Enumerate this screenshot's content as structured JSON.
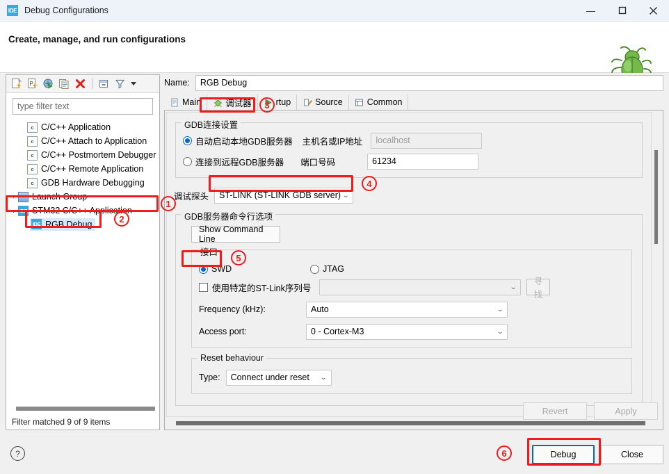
{
  "window": {
    "title": "Debug Configurations",
    "app_icon": "ide-icon",
    "minimize": "—",
    "maximize": "☐",
    "close": "✕"
  },
  "banner": {
    "heading": "Create, manage, and run configurations",
    "decoration_icon": "green-bug-icon"
  },
  "left_panel": {
    "toolbar_icons": [
      "new-configuration-icon",
      "new-prototype-icon",
      "export-icon",
      "duplicate-icon",
      "delete-icon",
      "collapse-all-icon",
      "filter-icon",
      "view-menu-caret-icon"
    ],
    "filter": {
      "placeholder": "type filter text",
      "value": ""
    },
    "tree": [
      {
        "label": "C/C++ Application",
        "icon": "c-file-icon",
        "indent": 1,
        "arrow": "",
        "selected": false
      },
      {
        "label": "C/C++ Attach to Application",
        "icon": "c-file-icon",
        "indent": 1,
        "arrow": "",
        "selected": false
      },
      {
        "label": "C/C++ Postmortem Debugger",
        "icon": "c-file-icon",
        "indent": 1,
        "arrow": "",
        "selected": false
      },
      {
        "label": "C/C++ Remote Application",
        "icon": "c-file-icon",
        "indent": 1,
        "arrow": "",
        "selected": false
      },
      {
        "label": "GDB Hardware Debugging",
        "icon": "c-file-icon",
        "indent": 1,
        "arrow": "",
        "selected": false
      },
      {
        "label": "Launch Group",
        "icon": "launch-group-icon",
        "indent": 0,
        "arrow": "›",
        "selected": false
      },
      {
        "label": "STM32 C/C++ Application",
        "icon": "ide-icon",
        "indent": 0,
        "arrow": "⌄",
        "selected": false
      },
      {
        "label": "RGB Debug",
        "icon": "ide-icon",
        "indent": 2,
        "arrow": "",
        "selected": true
      }
    ],
    "status": "Filter matched 9 of 9 items"
  },
  "right_panel": {
    "name_label": "Name:",
    "name_value": "RGB Debug",
    "tabs": [
      {
        "label": "Main",
        "icon": "page-icon",
        "active": false
      },
      {
        "label": "调试器",
        "icon": "debugger-icon",
        "active": true
      },
      {
        "label": "rtup",
        "icon": "startup-icon",
        "active": false
      },
      {
        "label": "Source",
        "icon": "source-icon",
        "active": false
      },
      {
        "label": "Common",
        "icon": "common-icon",
        "active": false
      }
    ],
    "gdb_connection": {
      "group_title": "GDB连接设置",
      "auto_start_label": "自动启动本地GDB服务器",
      "auto_start_selected": true,
      "remote_label": "连接到远程GDB服务器",
      "remote_selected": false,
      "host_label": "主机名或IP地址",
      "host_value": "localhost",
      "host_disabled": true,
      "port_label": "端口号码",
      "port_value": "61234"
    },
    "probe": {
      "label": "调试探头",
      "value": "ST-LINK (ST-LINK GDB server)"
    },
    "server_options": {
      "group_title": "GDB服务器命令行选项",
      "show_command_line": "Show Command Line",
      "interface": {
        "group_title": "接口",
        "swd_label": "SWD",
        "swd_selected": true,
        "jtag_label": "JTAG",
        "jtag_selected": false,
        "serial_checkbox_label": "使用特定的ST-Link序列号",
        "serial_checked": false,
        "serial_value": "",
        "scan_button": "寻找",
        "frequency_label": "Frequency (kHz):",
        "frequency_value": "Auto",
        "access_port_label": "Access port:",
        "access_port_value": "0 - Cortex-M3"
      },
      "reset": {
        "group_title": "Reset behaviour",
        "type_label": "Type:",
        "type_value": "Connect under reset"
      }
    }
  },
  "bottom": {
    "help_icon": "?",
    "revert": "Revert",
    "apply": "Apply",
    "debug": "Debug",
    "close": "Close"
  },
  "annotations": {
    "markers": [
      "1",
      "2",
      "3",
      "4",
      "5",
      "6"
    ],
    "accent_color": "#ee1c1c"
  }
}
